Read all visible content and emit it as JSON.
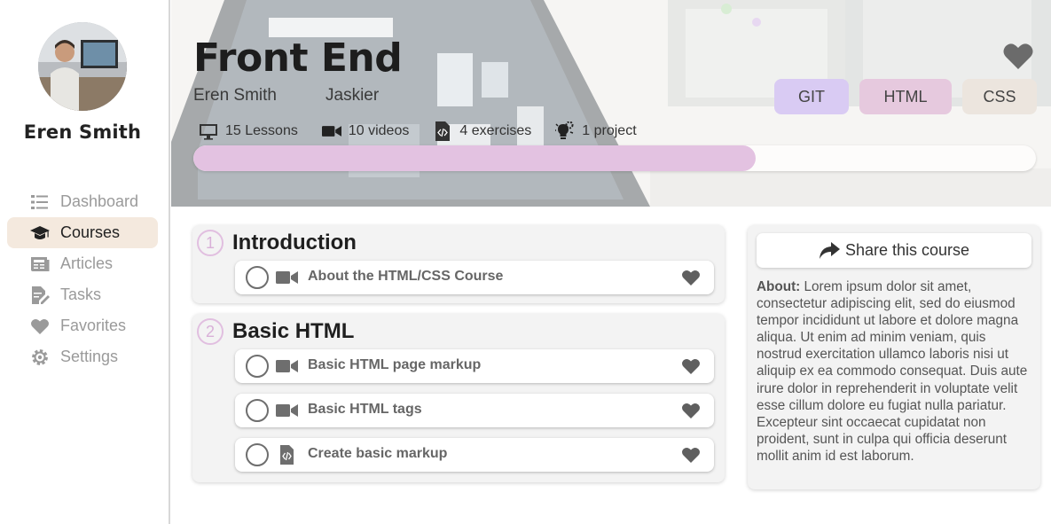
{
  "sidebar": {
    "user_name": "Eren Smith",
    "items": [
      {
        "label": "Dashboard",
        "icon": "list-icon",
        "active": false
      },
      {
        "label": "Courses",
        "icon": "graduation-cap-icon",
        "active": true
      },
      {
        "label": "Articles",
        "icon": "newspaper-icon",
        "active": false
      },
      {
        "label": "Tasks",
        "icon": "edit-document-icon",
        "active": false
      },
      {
        "label": "Favorites",
        "icon": "heart-icon",
        "active": false
      },
      {
        "label": "Settings",
        "icon": "gear-icon",
        "active": false
      }
    ]
  },
  "hero": {
    "title": "Front End",
    "authors": [
      "Eren Smith",
      "Jaskier"
    ],
    "tags": [
      "GIT",
      "HTML",
      "CSS"
    ],
    "stats": [
      {
        "label": "15 Lessons",
        "icon": "monitor-icon"
      },
      {
        "label": "10 videos",
        "icon": "video-camera-icon"
      },
      {
        "label": "4 exercises",
        "icon": "code-file-icon"
      },
      {
        "label": "1 project",
        "icon": "lightbulb-gear-icon"
      }
    ],
    "progress_fraction": 0.667,
    "colors": {
      "progress": "#e3c2e1",
      "git": "#d9cbf3",
      "html": "#e6c9de",
      "css": "#ece5de",
      "active_nav": "#f4e9de"
    }
  },
  "sections": [
    {
      "number": "1",
      "title": "Introduction",
      "lessons": [
        {
          "title": "About the HTML/CSS Course",
          "type": "video"
        }
      ]
    },
    {
      "number": "2",
      "title": "Basic HTML",
      "lessons": [
        {
          "title": "Basic HTML page markup",
          "type": "video"
        },
        {
          "title": "Basic HTML tags",
          "type": "video"
        },
        {
          "title": "Create basic markup",
          "type": "exercise"
        }
      ]
    }
  ],
  "about": {
    "share_label": "Share this course",
    "label": "About:",
    "text": "Lorem ipsum dolor sit amet, consectetur adipiscing elit, sed do eiusmod tempor incididunt ut labore et dolore magna aliqua. Ut enim ad minim veniam, quis nostrud exercitation ullamco laboris nisi ut aliquip ex ea commodo consequat. Duis aute irure dolor in reprehenderit in voluptate velit esse cillum dolore eu fugiat nulla pariatur. Excepteur sint occaecat cupidatat non proident, sunt in culpa qui officia deserunt mollit anim id est laborum."
  }
}
